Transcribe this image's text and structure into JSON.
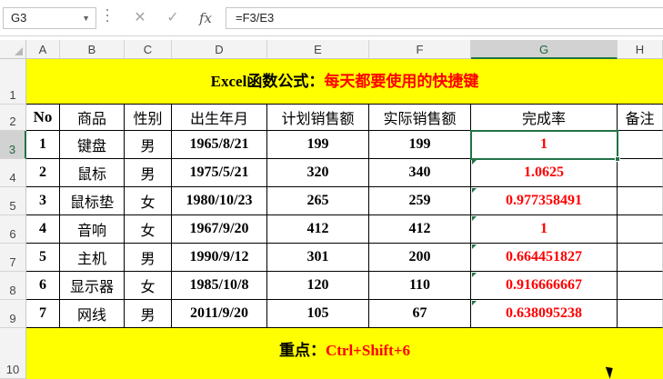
{
  "formula_bar": {
    "name_box": "G3",
    "cancel_icon": "✕",
    "enter_icon": "✓",
    "fx_label": "fx",
    "formula": "=F3/E3"
  },
  "columns": [
    "A",
    "B",
    "C",
    "D",
    "E",
    "F",
    "G",
    "H"
  ],
  "row_numbers": [
    "1",
    "2",
    "3",
    "4",
    "5",
    "6",
    "7",
    "8",
    "9",
    "10"
  ],
  "title": {
    "prefix": "Excel函数公式：",
    "highlight": "每天都要使用的快捷键"
  },
  "table": {
    "headers": [
      "No",
      "商品",
      "性别",
      "出生年月",
      "计划销售额",
      "实际销售额",
      "完成率",
      "备注"
    ],
    "rows": [
      [
        "1",
        "键盘",
        "男",
        "1965/8/21",
        "199",
        "199",
        "1",
        ""
      ],
      [
        "2",
        "鼠标",
        "男",
        "1975/5/21",
        "320",
        "340",
        "1.0625",
        ""
      ],
      [
        "3",
        "鼠标垫",
        "女",
        "1980/10/23",
        "265",
        "259",
        "0.977358491",
        ""
      ],
      [
        "4",
        "音响",
        "女",
        "1967/9/20",
        "412",
        "412",
        "1",
        ""
      ],
      [
        "5",
        "主机",
        "男",
        "1990/9/12",
        "301",
        "200",
        "0.664451827",
        ""
      ],
      [
        "6",
        "显示器",
        "女",
        "1985/10/8",
        "120",
        "110",
        "0.916666667",
        ""
      ],
      [
        "7",
        "网线",
        "男",
        "2011/9/20",
        "105",
        "67",
        "0.638095238",
        ""
      ]
    ]
  },
  "footer": {
    "prefix": "重点：",
    "highlight": "Ctrl+Shift+6"
  },
  "selected_cell": "G3",
  "colors": {
    "banner": "#ffff00",
    "accent_red": "#ff0000",
    "excel_green": "#217346"
  }
}
